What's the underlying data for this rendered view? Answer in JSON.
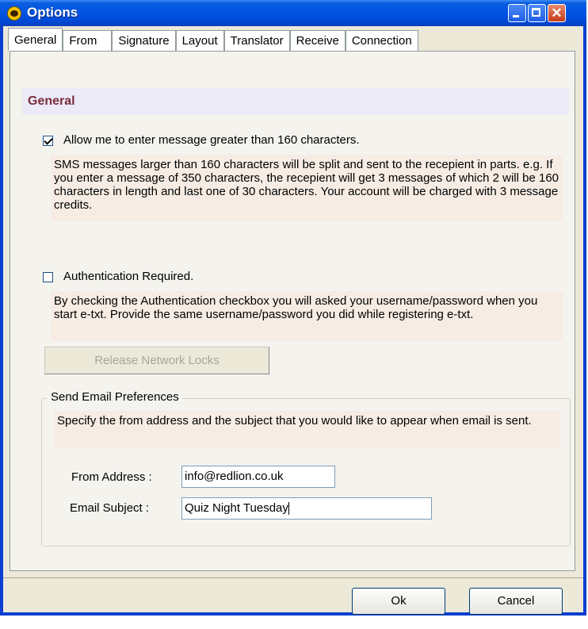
{
  "window": {
    "title": "Options"
  },
  "tabs": [
    "General",
    "From",
    "Signature",
    "Layout",
    "Translator",
    "Receive",
    "Connection"
  ],
  "section": {
    "title": "General"
  },
  "long_sms": {
    "label": "Allow me to enter message greater than 160 characters.",
    "checked": true,
    "info": "SMS messages larger than 160 characters will be split and sent to the recepient in parts. e.g. If you enter a message of 350 characters, the recepient will get 3 messages  of which 2 will be 160 characters in length and last one of 30 characters. Your account will be charged with 3 message credits."
  },
  "auth": {
    "label": "Authentication Required.",
    "checked": false,
    "info": "By checking the Authentication checkbox you will asked your username/password when you start e-txt. Provide the same username/password you did while registering e-txt."
  },
  "release_button": "Release Network Locks",
  "email_prefs": {
    "title": "Send Email Preferences",
    "info": "Specify the from address and the subject that you would like to appear when email is sent.",
    "from_label": "From Address :",
    "from_value": "info@redlion.co.uk",
    "subject_label": "Email Subject :",
    "subject_value": "Quiz Night Tuesday"
  },
  "buttons": {
    "ok": "Ok",
    "cancel": "Cancel"
  },
  "colors": {
    "titlebar": "#0153e3",
    "section_text": "#7b2d3d",
    "section_bg": "#ebeaf6",
    "info_bg": "#f6ece4"
  }
}
